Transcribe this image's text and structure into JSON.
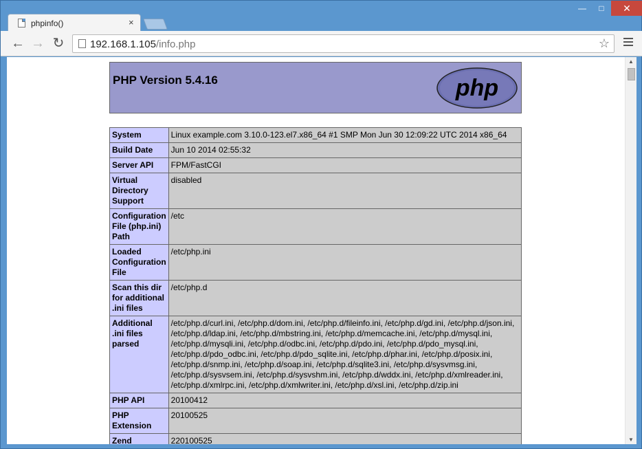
{
  "browser": {
    "tab_title": "phpinfo()",
    "tab_close": "×",
    "url_host": "192.168.1.105",
    "url_path": "/info.php",
    "window_controls": {
      "minimize": "—",
      "maximize": "□",
      "close": "✕"
    }
  },
  "page": {
    "title": "PHP Version 5.4.16",
    "logo_text": "php",
    "rows": [
      {
        "key": "System",
        "value": "Linux example.com 3.10.0-123.el7.x86_64 #1 SMP Mon Jun 30 12:09:22 UTC 2014 x86_64"
      },
      {
        "key": "Build Date",
        "value": "Jun 10 2014 02:55:32"
      },
      {
        "key": "Server API",
        "value": "FPM/FastCGI"
      },
      {
        "key": "Virtual Directory Support",
        "value": "disabled"
      },
      {
        "key": "Configuration File (php.ini) Path",
        "value": "/etc"
      },
      {
        "key": "Loaded Configuration File",
        "value": "/etc/php.ini"
      },
      {
        "key": "Scan this dir for additional .ini files",
        "value": "/etc/php.d"
      },
      {
        "key": "Additional .ini files parsed",
        "value": "/etc/php.d/curl.ini, /etc/php.d/dom.ini, /etc/php.d/fileinfo.ini, /etc/php.d/gd.ini, /etc/php.d/json.ini, /etc/php.d/ldap.ini, /etc/php.d/mbstring.ini, /etc/php.d/memcache.ini, /etc/php.d/mysql.ini, /etc/php.d/mysqli.ini, /etc/php.d/odbc.ini, /etc/php.d/pdo.ini, /etc/php.d/pdo_mysql.ini, /etc/php.d/pdo_odbc.ini, /etc/php.d/pdo_sqlite.ini, /etc/php.d/phar.ini, /etc/php.d/posix.ini, /etc/php.d/snmp.ini, /etc/php.d/soap.ini, /etc/php.d/sqlite3.ini, /etc/php.d/sysvmsg.ini, /etc/php.d/sysvsem.ini, /etc/php.d/sysvshm.ini, /etc/php.d/wddx.ini, /etc/php.d/xmlreader.ini, /etc/php.d/xmlrpc.ini, /etc/php.d/xmlwriter.ini, /etc/php.d/xsl.ini, /etc/php.d/zip.ini"
      },
      {
        "key": "PHP API",
        "value": "20100412"
      },
      {
        "key": "PHP Extension",
        "value": "20100525"
      },
      {
        "key": "Zend",
        "value": "220100525"
      }
    ]
  }
}
